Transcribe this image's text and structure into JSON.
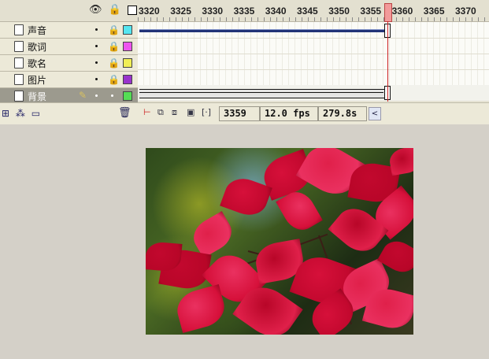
{
  "timeline": {
    "ruler_labels": [
      "3320",
      "3325",
      "3330",
      "3335",
      "3340",
      "3345",
      "3350",
      "3355",
      "3360",
      "3365",
      "3370"
    ],
    "header_icons": {
      "eye": "eye-icon",
      "lock": "lock-icon",
      "outline": "outline-box-icon"
    },
    "layers": [
      {
        "name": "声音",
        "color": "#55e6f0",
        "selected": false
      },
      {
        "name": "歌词",
        "color": "#ee55ee",
        "selected": false
      },
      {
        "name": "歌名",
        "color": "#f0ee55",
        "selected": false
      },
      {
        "name": "图片",
        "color": "#9933cc",
        "selected": false
      },
      {
        "name": "背景",
        "color": "#55dd55",
        "selected": true
      }
    ]
  },
  "status": {
    "current_frame": "3359",
    "fps": "12.0 fps",
    "elapsed": "279.8s",
    "scroll_left": "<"
  },
  "glyphs": {
    "eye": "👁",
    "lock": "🔒",
    "dot": "•",
    "pencil": "✎",
    "add_layer": "⊞",
    "add_guide": "⁂",
    "add_folder": "▭",
    "trash": "🗑",
    "onion_center": "⊢",
    "onion": "⧉",
    "onion_outline": "⧈",
    "edit_multiple": "▣",
    "onion_markers": "[·]"
  }
}
